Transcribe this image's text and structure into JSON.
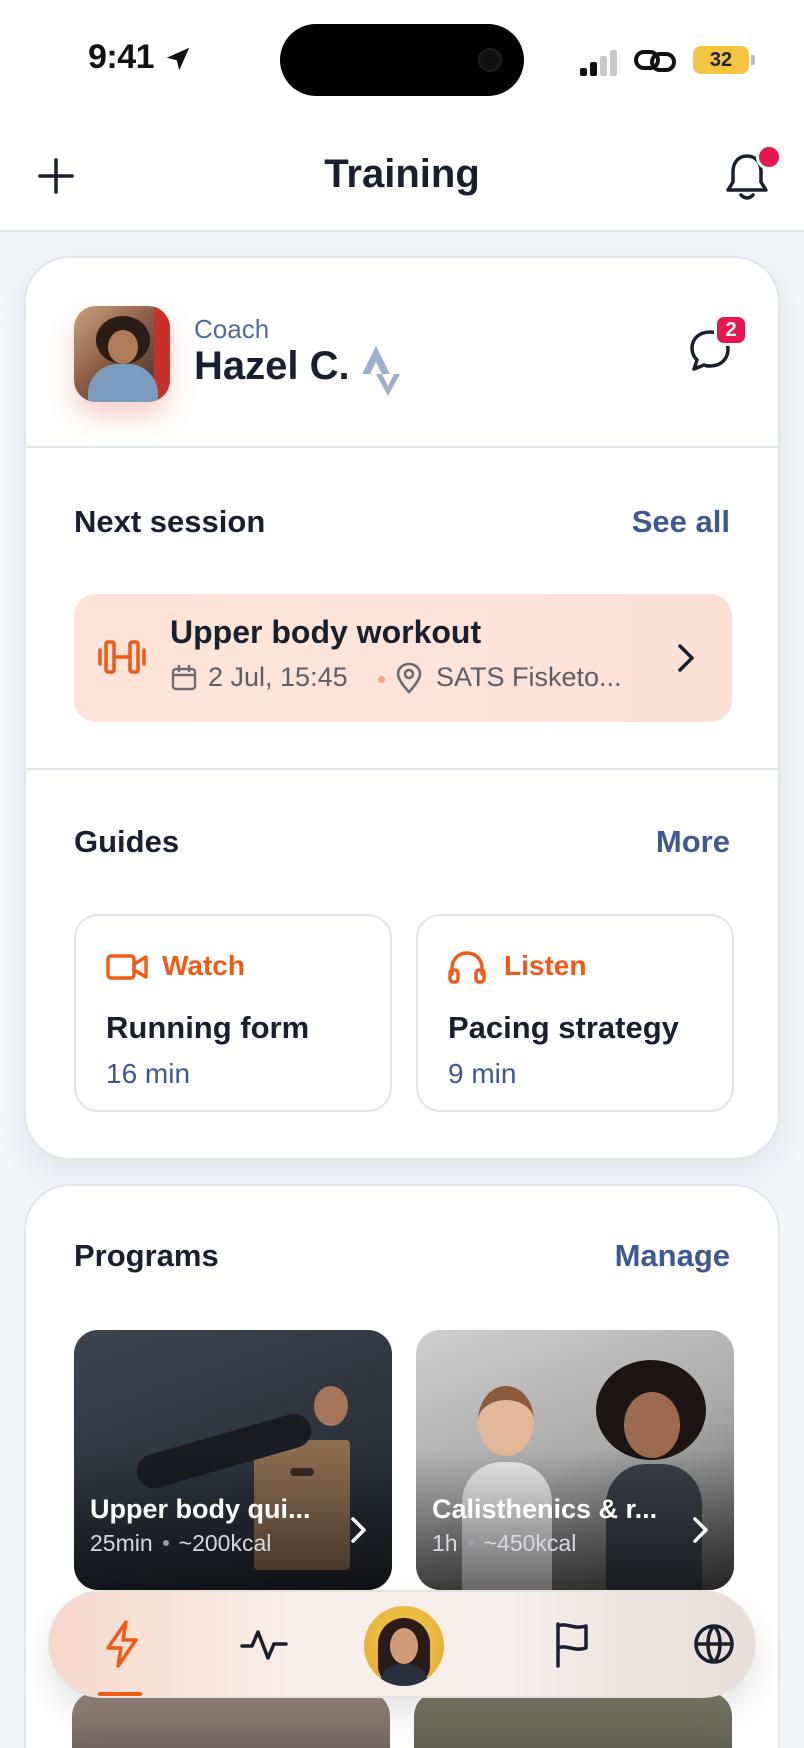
{
  "status": {
    "time": "9:41",
    "battery": "32"
  },
  "header": {
    "title": "Training",
    "add_icon": "plus-icon",
    "notifications_icon": "bell-icon"
  },
  "coach": {
    "label": "Coach",
    "name": "Hazel C.",
    "unread_messages": "2"
  },
  "next_session": {
    "heading": "Next session",
    "link": "See all",
    "title": "Upper body workout",
    "date": "2 Jul, 15:45",
    "location": "SATS Fisketo..."
  },
  "guides": {
    "heading": "Guides",
    "link": "More",
    "items": [
      {
        "type": "Watch",
        "title": "Running form",
        "duration": "16 min",
        "icon": "video-icon"
      },
      {
        "type": "Listen",
        "title": "Pacing strategy",
        "duration": "9 min",
        "icon": "headphones-icon"
      }
    ]
  },
  "programs": {
    "heading": "Programs",
    "link": "Manage",
    "items": [
      {
        "title": "Upper body qui...",
        "duration": "25min",
        "calories": "~200kcal"
      },
      {
        "title": "Calisthenics & r...",
        "duration": "1h",
        "calories": "~450kcal"
      }
    ]
  },
  "tabbar": {
    "tabs": [
      "lightning-icon",
      "activity-icon",
      "profile-avatar",
      "flag-icon",
      "globe-icon"
    ],
    "active": "lightning-icon"
  },
  "colors": {
    "accent": "#f05a14",
    "link": "#3f5891",
    "badge": "#e8174f",
    "text": "#1a1f2e"
  }
}
